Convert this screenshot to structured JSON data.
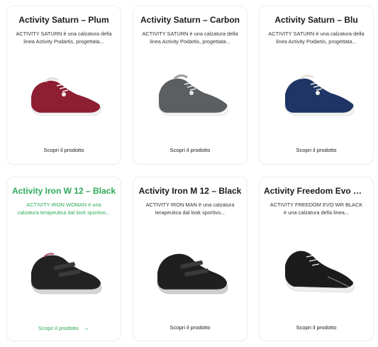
{
  "products": [
    {
      "name": "Activity Saturn – Plum",
      "description": "ACTIVITY SATURN è una calzatura della linea Activity Podartis, progettata...",
      "cta": "Scopri il prodotto",
      "color": "#8e1f33",
      "shoe_icon": "sneaker-laced-icon"
    },
    {
      "name": "Activity Saturn – Carbon",
      "description": "ACTIVITY SATURN è una calzatura della linea Activity Podartis, progettata...",
      "cta": "Scopri il prodotto",
      "color": "#5c5f62",
      "shoe_icon": "sneaker-laced-icon"
    },
    {
      "name": "Activity Saturn – Blu",
      "description": "ACTIVITY SATURN è una calzatura della linea Activity Podartis, progettata...",
      "cta": "Scopri il prodotto",
      "color": "#1e3566",
      "shoe_icon": "sneaker-laced-icon"
    },
    {
      "name": "Activity Iron W 12 – Black",
      "description": "ACTIVITY IRON WOMAN è una calzatura terapeutica dal look sportivo...",
      "cta": "Scopri il prodotto",
      "cta_arrow": "→",
      "color": "#222222",
      "shoe_icon": "sneaker-velcro-icon",
      "highlighted": true
    },
    {
      "name": "Activity Iron M 12 – Black",
      "description": "ACTIVITY IRON MAN è una calzatura terapeutica dal look sportivo...",
      "cta": "Scopri il prodotto",
      "color": "#1f1f1f",
      "shoe_icon": "sneaker-velcro-icon"
    },
    {
      "name": "Activity Freedom Evo Wr -...",
      "description": "ACTIVITY FREEDOM EVO WR BLACK è una calzatura della linea...",
      "cta": "Scopri il prodotto",
      "color": "#1b1b1b",
      "shoe_icon": "sneaker-runner-icon"
    }
  ],
  "colors": {
    "accent": "#2eaa58",
    "card_border": "#ececec",
    "sole": "#f2f2f2"
  }
}
